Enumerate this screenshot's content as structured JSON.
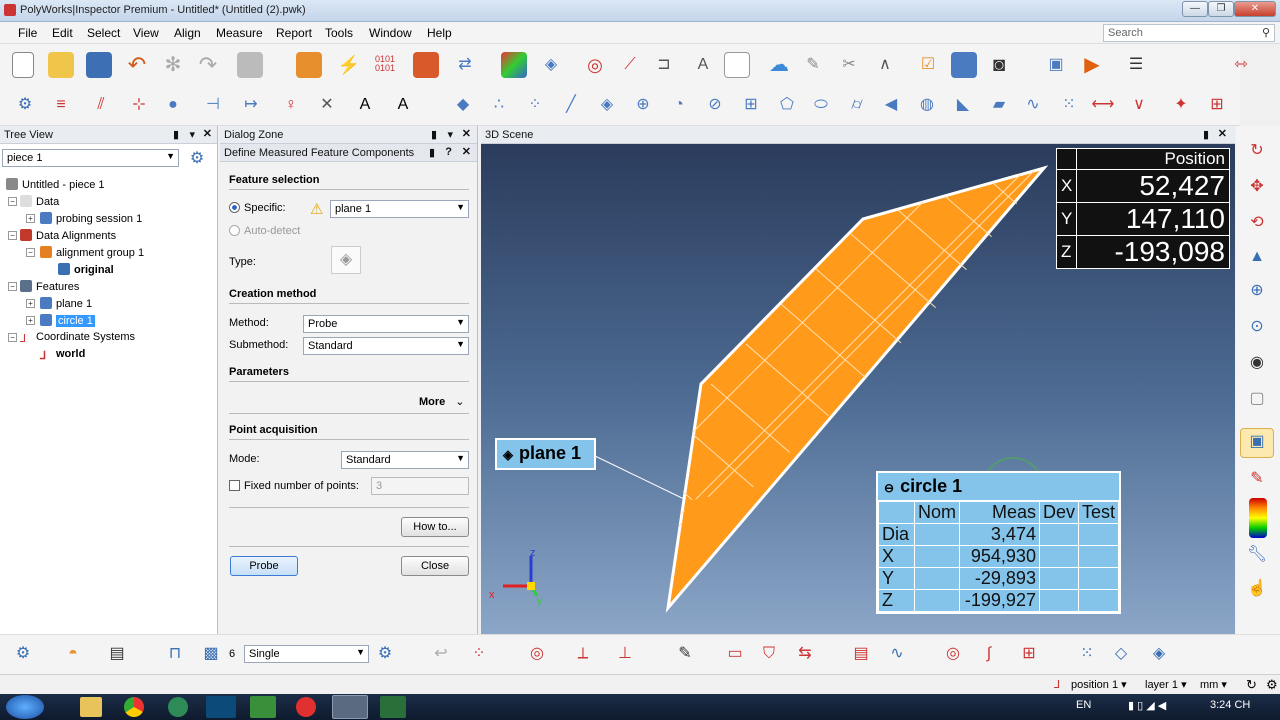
{
  "window": {
    "title": "PolyWorks|Inspector Premium - Untitled* (Untitled (2).pwk)"
  },
  "menu": [
    "File",
    "Edit",
    "Select",
    "View",
    "Align",
    "Measure",
    "Report",
    "Tools",
    "Window",
    "Help"
  ],
  "search": {
    "placeholder": "Search"
  },
  "tree": {
    "header": "Tree View",
    "piece_select": "piece 1",
    "items": {
      "root": "Untitled - piece 1",
      "data": "Data",
      "probing_session": "probing session 1",
      "data_alignments": "Data Alignments",
      "alignment_group": "alignment group 1",
      "original": "original",
      "features": "Features",
      "plane": "plane 1",
      "circle": "circle 1",
      "coord_systems": "Coordinate Systems",
      "world": "world"
    }
  },
  "dialog": {
    "zone_header": "Dialog Zone",
    "title": "Define Measured Feature Components",
    "feature_selection": "Feature selection",
    "specific_label": "Specific:",
    "specific_value": "plane 1",
    "auto_detect": "Auto-detect",
    "type_label": "Type:",
    "creation_method": "Creation method",
    "method_label": "Method:",
    "method_value": "Probe",
    "submethod_label": "Submethod:",
    "submethod_value": "Standard",
    "parameters": "Parameters",
    "more": "More",
    "point_acquisition": "Point acquisition",
    "mode_label": "Mode:",
    "mode_value": "Standard",
    "fixed_points_label": "Fixed number of points:",
    "fixed_points_value": "3",
    "howto": "How to...",
    "probe": "Probe",
    "close": "Close"
  },
  "scene": {
    "header": "3D Scene",
    "position": {
      "title": "Position",
      "x_label": "X",
      "x": "52,427",
      "y_label": "Y",
      "y": "147,110",
      "z_label": "Z",
      "z": "-193,098"
    },
    "plane_label": "plane 1",
    "circle": {
      "name": "circle 1",
      "headers": [
        "",
        "Nom",
        "Meas",
        "Dev",
        "Test"
      ],
      "rows": [
        [
          "Dia",
          "",
          "3,474",
          "",
          ""
        ],
        [
          "X",
          "",
          "954,930",
          "",
          ""
        ],
        [
          "Y",
          "",
          "-29,893",
          "",
          ""
        ],
        [
          "Z",
          "",
          "-199,927",
          "",
          ""
        ]
      ]
    },
    "axes": {
      "x": "x",
      "y": "y",
      "z": "z"
    }
  },
  "bottom": {
    "count": "6",
    "mode": "Single"
  },
  "status": {
    "position": "position 1",
    "layer": "layer 1",
    "unit": "mm"
  },
  "taskbar": {
    "lang": "EN",
    "time": "3:24 CH"
  },
  "colors": {
    "orange": "#ff9a1a",
    "scene_top": "#2b3c5c",
    "label_bg": "#84c4ea"
  }
}
